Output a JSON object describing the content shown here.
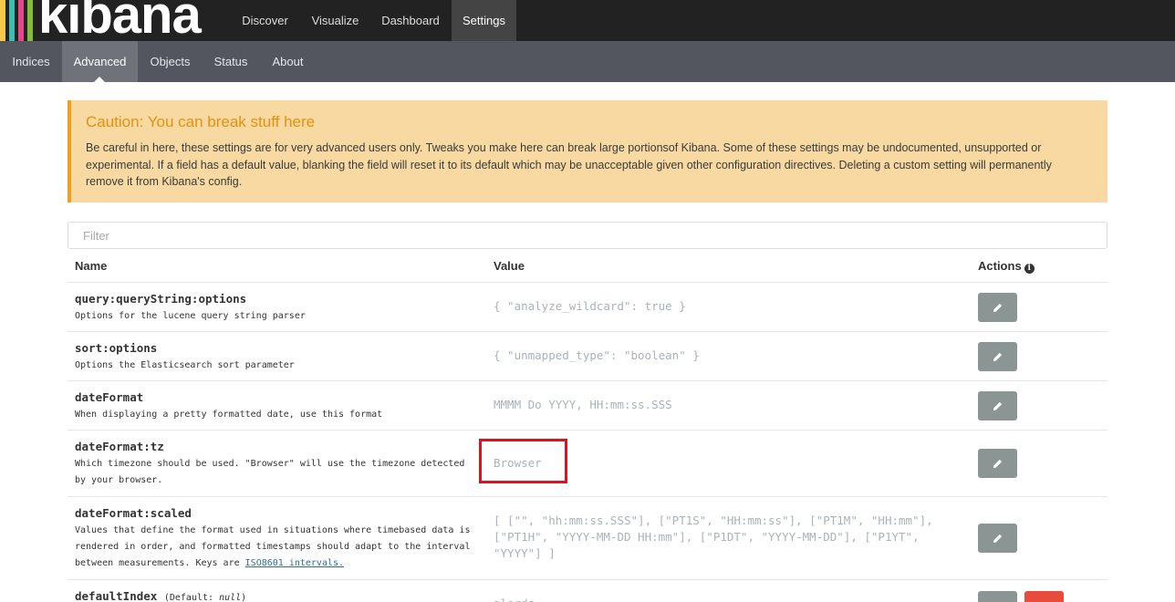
{
  "logo": {
    "text": "kibana",
    "colors": [
      "#f6c84b",
      "#3ebeb0",
      "#e8488b",
      "#83bb3c"
    ]
  },
  "top_nav": [
    {
      "label": "Discover",
      "active": false
    },
    {
      "label": "Visualize",
      "active": false
    },
    {
      "label": "Dashboard",
      "active": false
    },
    {
      "label": "Settings",
      "active": true
    }
  ],
  "sub_nav": [
    {
      "label": "Indices",
      "active": false
    },
    {
      "label": "Advanced",
      "active": true
    },
    {
      "label": "Objects",
      "active": false
    },
    {
      "label": "Status",
      "active": false
    },
    {
      "label": "About",
      "active": false
    }
  ],
  "warning": {
    "title": "Caution: You can break stuff here",
    "text": "Be careful in here, these settings are for very advanced users only. Tweaks you make here can break large portionsof Kibana. Some of these settings may be undocumented, unsupported or experimental. If a field has a default value, blanking the field will reset it to its default which may be unacceptable given other configuration directives. Deleting a custom setting will permanently remove it from Kibana's config."
  },
  "filter": {
    "placeholder": "Filter",
    "value": ""
  },
  "table": {
    "headers": {
      "name": "Name",
      "value": "Value",
      "actions": "Actions"
    },
    "rows": [
      {
        "name": "query:queryString:options",
        "description": "Options for the lucene query string parser",
        "value": "{ \"analyze_wildcard\": true }"
      },
      {
        "name": "sort:options",
        "description": "Options the Elasticsearch sort parameter",
        "value": "{ \"unmapped_type\": \"boolean\" }"
      },
      {
        "name": "dateFormat",
        "description": "When displaying a pretty formatted date, use this format",
        "value": "MMMM Do YYYY, HH:mm:ss.SSS"
      },
      {
        "name": "dateFormat:tz",
        "description": "Which timezone should be used. \"Browser\" will use the timezone detected by your browser.",
        "value": "Browser"
      },
      {
        "name": "dateFormat:scaled",
        "description": "Values that define the format used in situations where timebased data is rendered in order, and formatted timestamps should adapt to the interval between measurements. Keys are",
        "description_link": "ISO8601 intervals.",
        "value": "[ [\"\", \"hh:mm:ss.SSS\"], [\"PT1S\", \"HH:mm:ss\"], [\"PT1M\", \"HH:mm\"], [\"PT1H\", \"YYYY-MM-DD HH:mm\"], [\"P1DT\", \"YYYY-MM-DD\"], [\"P1YT\", \"YYYY\"] ]"
      },
      {
        "name": "defaultIndex",
        "default_note_prefix": "(Default:",
        "default_note_value": "null",
        "default_note_suffix": ")",
        "value": "alerds"
      }
    ]
  },
  "accent_colors": {
    "edit_button": "#8a9594",
    "delete_button": "#e74c3c",
    "highlight_box": "#d9141c",
    "warning_bg": "#f8d9a2",
    "warning_title": "#e8900c"
  }
}
